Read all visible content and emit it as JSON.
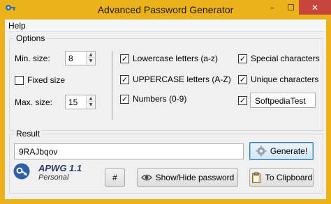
{
  "window": {
    "title": "Advanced Password Generator",
    "minimize_glyph": "–",
    "maximize_glyph": "☐",
    "close_glyph": "✕",
    "frame_color": "#ebb21c",
    "close_color": "#c7463b"
  },
  "menu": {
    "help": "Help"
  },
  "options": {
    "group_label": "Options",
    "min_size_label": "Min. size:",
    "min_size_value": "8",
    "fixed_size_label": "Fixed size",
    "fixed_size_checked": false,
    "max_size_label": "Max. size:",
    "max_size_value": "15",
    "lowercase_label": "Lowercase letters (a-z)",
    "lowercase_checked": true,
    "uppercase_label": "UPPERCASE letters (A-Z)",
    "uppercase_checked": true,
    "numbers_label": "Numbers (0-9)",
    "numbers_checked": true,
    "special_label": "Special characters",
    "special_checked": true,
    "unique_label": "Unique characters",
    "unique_checked": true,
    "custom_checked": true,
    "custom_value": "SoftpediaTest"
  },
  "result": {
    "group_label": "Result",
    "password": "9RAJbqov",
    "generate_label": "Generate!",
    "hash_label": "#",
    "show_hide_label": "Show/Hide password",
    "clipboard_label": "To Clipboard"
  },
  "branding": {
    "name": "APWG 1.1",
    "edition": "Personal"
  },
  "icons": {
    "app": "key-icon",
    "generate": "gear-icon",
    "show_hide": "eye-icon",
    "clipboard": "clipboard-icon",
    "logo": "key-icon"
  }
}
